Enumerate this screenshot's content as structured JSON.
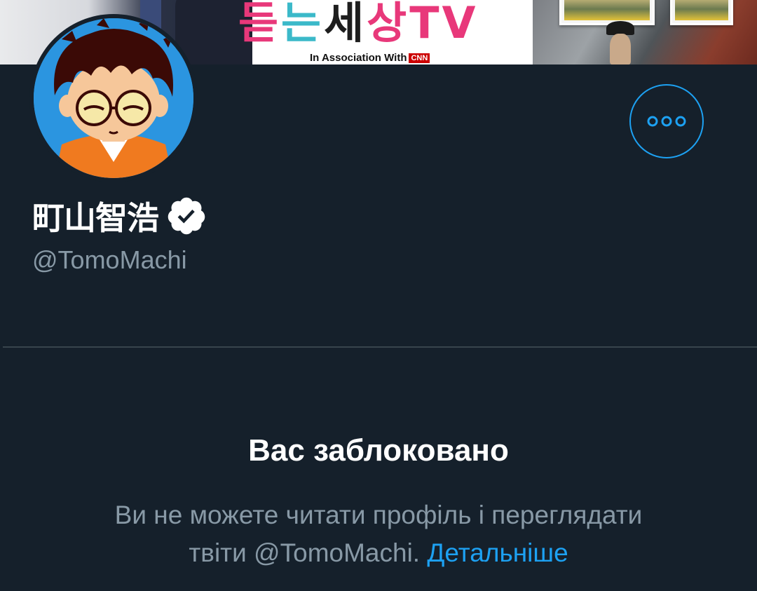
{
  "banner": {
    "logo_text": "듣는 세상 TV",
    "association": "In Association With",
    "cnn": "CNN"
  },
  "profile": {
    "display_name": "町山智浩",
    "handle": "@TomoMachi",
    "verified": true,
    "avatar_icon": "avatar-cartoon-glasses",
    "more_icon": "more-horizontal-icon"
  },
  "blocked": {
    "title": "Вас заблоковано",
    "message_part1": "Ви не можете читати профіль і переглядати",
    "message_part2": "твіти @TomoMachi. ",
    "learn_more": "Детальніше"
  },
  "colors": {
    "background": "#15202b",
    "accent": "#1da1f2",
    "secondary_text": "#8899a6",
    "divider": "#38444d"
  }
}
